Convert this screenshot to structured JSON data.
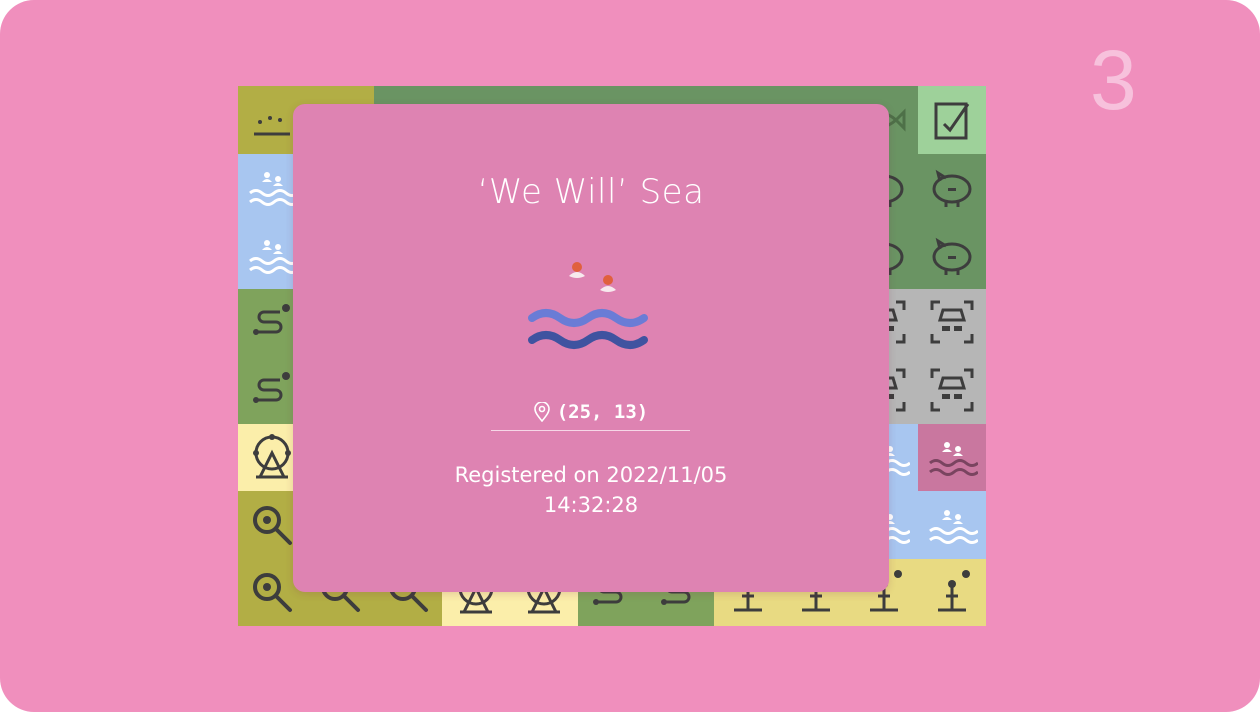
{
  "slide_number": "3",
  "tile": {
    "name": "‘We Will’ Sea",
    "coordinates": "(25, 13)",
    "registered_label": "Registered on 2022/11/05",
    "registered_time": "14:32:28"
  },
  "colors": {
    "background": "#f08fbd",
    "modal": "#de83b2",
    "wave_dark": "#3f53a0",
    "wave_light": "#6a7cd6",
    "heart": "#e0603e"
  },
  "map_tiles": [
    [
      "olive-sprout",
      "olive",
      "green-fish",
      "green-fish",
      "green-fish",
      "green-fish",
      "green-fish",
      "green-fish",
      "green-fish",
      "green-fish",
      "signpen"
    ],
    [
      "sea",
      "green",
      "green",
      "green",
      "green",
      "green",
      "green",
      "green",
      "green",
      "pig",
      "pig"
    ],
    [
      "sea",
      "green",
      "green",
      "green",
      "green",
      "green",
      "green",
      "green",
      "green",
      "pig",
      "pig"
    ],
    [
      "path",
      "green",
      "green",
      "green",
      "green",
      "green",
      "green",
      "green",
      "green",
      "spy",
      "spy"
    ],
    [
      "path",
      "green",
      "green",
      "green",
      "green",
      "green",
      "green",
      "green",
      "green",
      "spy",
      "spy"
    ],
    [
      "ferris",
      "green",
      "green",
      "green",
      "green",
      "green",
      "green",
      "green",
      "green",
      "sea",
      "selected-sea"
    ],
    [
      "search",
      "green",
      "green",
      "green",
      "green",
      "green",
      "green",
      "green",
      "green",
      "sea",
      "sea"
    ],
    [
      "search",
      "search",
      "search",
      "ferris-yellow",
      "ferris-yellow",
      "path",
      "path",
      "signpost",
      "signpost",
      "signpost",
      "signpost"
    ]
  ]
}
